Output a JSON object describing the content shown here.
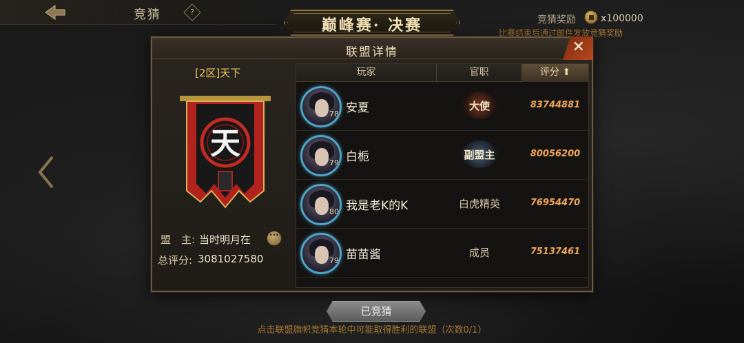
{
  "topbar": {
    "back_icon": "back-arrow-icon",
    "title": "竞猜",
    "help_label": "?"
  },
  "stage": {
    "title": "巅峰赛· 决赛"
  },
  "reward": {
    "label": "竞猜奖励",
    "coin_icon": "copper-coin-icon",
    "amount": "x100000",
    "note": "比赛结束后通过邮件发放竞猜奖励"
  },
  "panel": {
    "title": "联盟详情",
    "close_label": "✕",
    "alliance": {
      "name": "[2区]天下",
      "flag_char": "天",
      "leader_label": "盟　主:",
      "leader_name": "当时明月在",
      "score_label": "总评分:",
      "score_value": "3081027580"
    },
    "table": {
      "columns": {
        "player": "玩家",
        "role": "官职",
        "score": "评分",
        "score_sort_icon": "sort-up-arrow-icon"
      },
      "rows": [
        {
          "name": "安夏",
          "level": "78",
          "role": "大使",
          "score": "83744881"
        },
        {
          "name": "白栀",
          "level": "79",
          "role": "副盟主",
          "score": "80056200"
        },
        {
          "name": "我是老K的K",
          "level": "80",
          "role": "白虎精英",
          "score": "76954470"
        },
        {
          "name": "苗苗酱",
          "level": "79",
          "role": "成员",
          "score": "75137461"
        }
      ]
    }
  },
  "footer": {
    "button_label": "已竞猜",
    "hint": "点击联盟旗帜竞猜本轮中可能取得胜利的联盟（次数0/1）"
  },
  "colors": {
    "accent_gold": "#f0c75a",
    "score_orange": "#f2a658",
    "close_red": "#b8491c",
    "hint_brown": "#a97a32"
  }
}
